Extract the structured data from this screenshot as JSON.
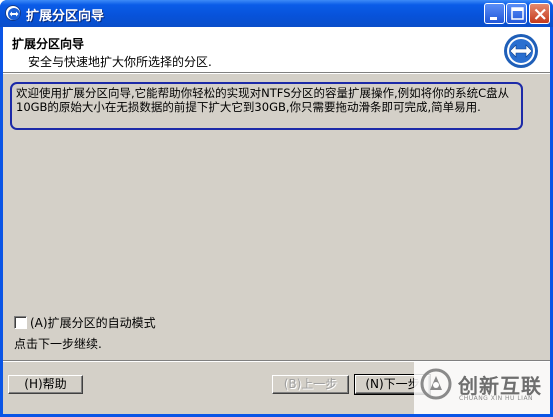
{
  "window": {
    "title": "扩展分区向导"
  },
  "header": {
    "title": "扩展分区向导",
    "subtitle": "安全与快速地扩大你所选择的分区."
  },
  "intro": {
    "text": "欢迎使用扩展分区向导,它能帮助你轻松的实现对NTFS分区的容量扩展操作,例如将你的系统C盘从10GB的原始大小在无损数据的前提下扩大它到30GB,你只需要拖动滑条即可完成,简单易用."
  },
  "auto_mode": {
    "label": "(A)扩展分区的自动模式",
    "checked": false
  },
  "hint": "点击下一步继续.",
  "buttons": {
    "help": "(H)帮助",
    "back": "(B)上一步",
    "next": "(N)下一步"
  },
  "watermark": {
    "text": "创新互联",
    "sub": "CHUANG XIN HU LIAN"
  },
  "colors": {
    "titlebar": "#0a55e6",
    "intro_border": "#1c2aa8",
    "face": "#d4d0c8"
  }
}
